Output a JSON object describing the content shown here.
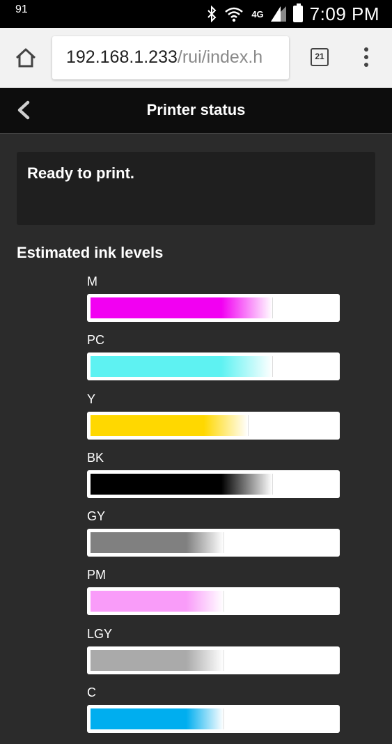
{
  "status_bar": {
    "notification_count": "91",
    "notification_sub": "⟟",
    "network": "4G",
    "time": "7:09 PM"
  },
  "browser": {
    "url_host": "192.168.1.233",
    "url_path": "/rui/index.h",
    "tab_count": "21"
  },
  "header": {
    "title": "Printer status"
  },
  "status": {
    "message": "Ready to print."
  },
  "ink": {
    "section_title": "Estimated ink levels",
    "cartridges": [
      {
        "label": "M",
        "level": 0.74,
        "color": "#f200f2"
      },
      {
        "label": "PC",
        "level": 0.74,
        "color": "#5ef2f2"
      },
      {
        "label": "Y",
        "level": 0.64,
        "color": "#ffd800"
      },
      {
        "label": "BK",
        "level": 0.74,
        "color": "#000000"
      },
      {
        "label": "GY",
        "level": 0.54,
        "color": "#808080"
      },
      {
        "label": "PM",
        "level": 0.54,
        "color": "#f99cf9"
      },
      {
        "label": "LGY",
        "level": 0.54,
        "color": "#aaaaaa"
      },
      {
        "label": "C",
        "level": 0.54,
        "color": "#00aeef"
      }
    ]
  }
}
